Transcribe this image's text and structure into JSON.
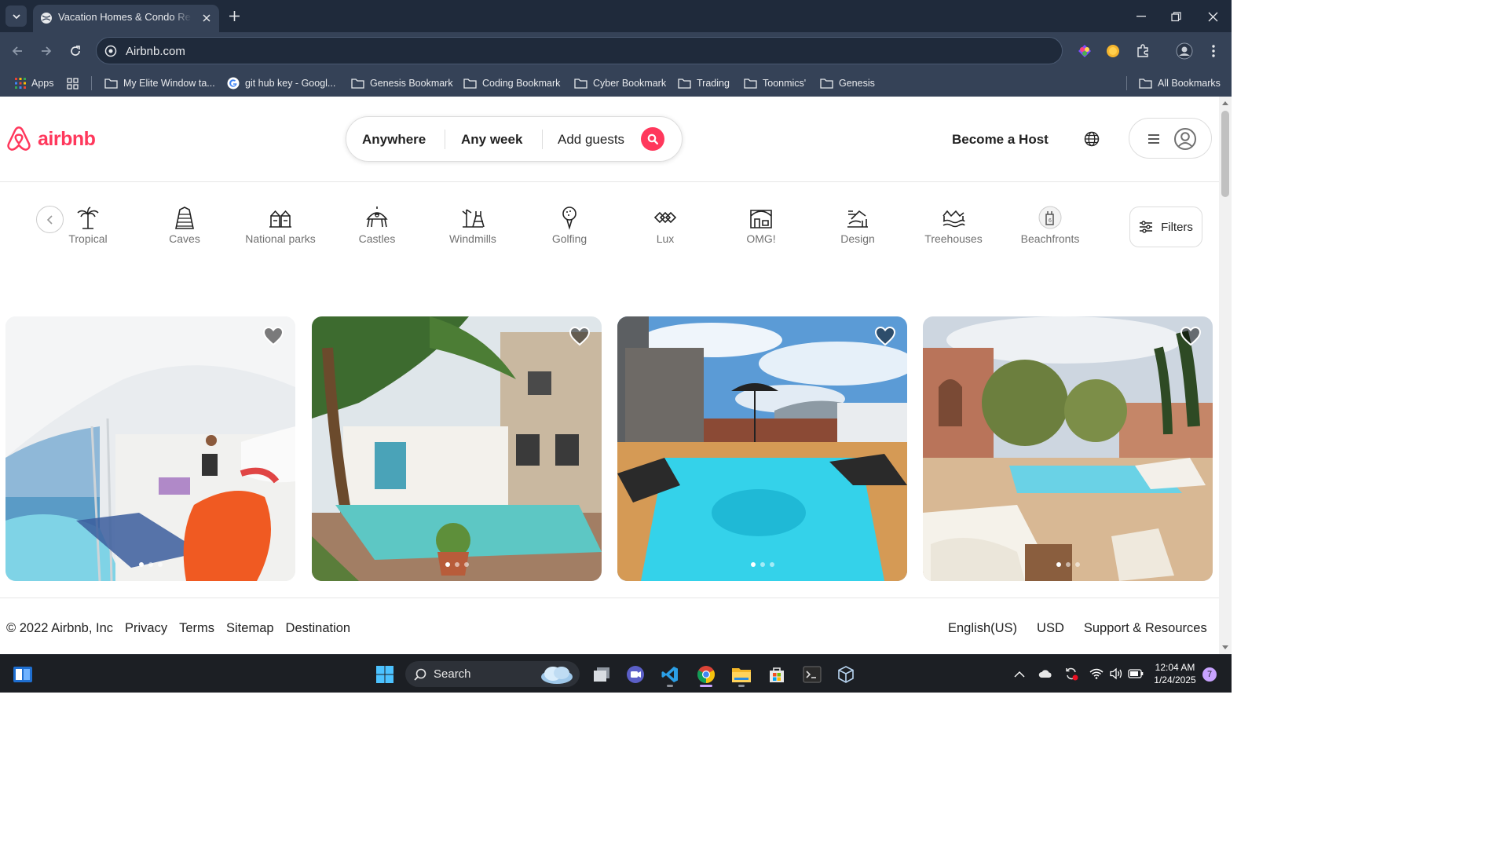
{
  "browser": {
    "tab_title": "Vacation Homes & Condo Rentals - Airbnb",
    "url": "Airbnb.com",
    "bookmarks": [
      {
        "label": "Apps"
      },
      {
        "label": "My Elite Window ta..."
      },
      {
        "label": "git hub key - Googl..."
      },
      {
        "label": "Genesis Bookmark"
      },
      {
        "label": "Coding Bookmark"
      },
      {
        "label": "Cyber Bookmark"
      },
      {
        "label": "Trading"
      },
      {
        "label": "Toonmics'"
      },
      {
        "label": "Genesis"
      }
    ],
    "all_bookmarks": "All Bookmarks"
  },
  "header": {
    "logo": "airbnb",
    "search": {
      "where": "Anywhere",
      "when": "Any week",
      "guests": "Add guests"
    },
    "host": "Become a Host"
  },
  "categories": [
    {
      "label": "Tropical",
      "icon": "palm-icon"
    },
    {
      "label": "Caves",
      "icon": "cave-icon"
    },
    {
      "label": "National parks",
      "icon": "park-icon"
    },
    {
      "label": "Castles",
      "icon": "castle-icon"
    },
    {
      "label": "Windmills",
      "icon": "windmill-icon"
    },
    {
      "label": "Golfing",
      "icon": "golf-icon"
    },
    {
      "label": "Lux",
      "icon": "diamond-icon"
    },
    {
      "label": "OMG!",
      "icon": "omg-house-icon"
    },
    {
      "label": "Design",
      "icon": "design-icon"
    },
    {
      "label": "Treehouses",
      "icon": "treehouse-icon"
    },
    {
      "label": "Beachfronts",
      "icon": "beach-icon"
    }
  ],
  "filters_label": "Filters",
  "listings": [
    {
      "photo": "modern-cliff-villa-with-infinity-pool",
      "dots": 3,
      "active_dot": 0
    },
    {
      "photo": "courtyard-pool-under-palm-trees",
      "dots": 3,
      "active_dot": 0
    },
    {
      "photo": "terrace-pool-with-sun-loungers",
      "dots": 3,
      "active_dot": 0
    },
    {
      "photo": "riad-garden-pool-with-daybeds",
      "dots": 3,
      "active_dot": 0
    }
  ],
  "footer": {
    "left": [
      "© 2022 Airbnb, Inc",
      "Privacy",
      "Terms",
      "Sitemap",
      "Destination"
    ],
    "right": [
      "English(US)",
      "USD",
      "Support & Resources"
    ]
  },
  "taskbar": {
    "search": "Search",
    "time": "12:04 AM",
    "date": "1/24/2025",
    "notifications": "7"
  },
  "colors": {
    "brand": "#ff385c",
    "chrome_dark": "#1f2a3b",
    "chrome": "#354257"
  }
}
